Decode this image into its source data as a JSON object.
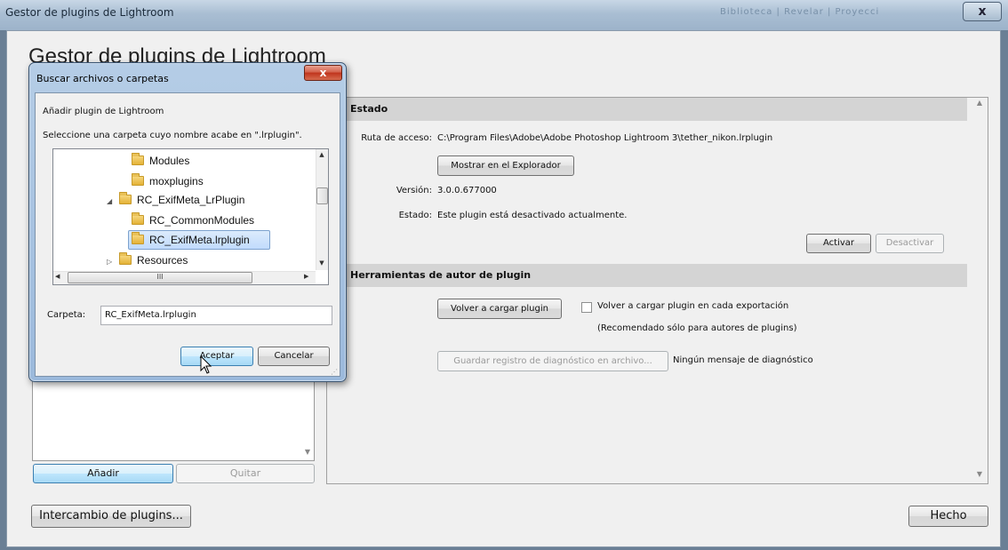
{
  "main_window": {
    "title": "Gestor de plugins de Lightroom",
    "titlebar_faded": "Biblioteca | Revelar | Proyecci",
    "close_label": "x",
    "heading": "Gestor de plugins de Lightroom"
  },
  "left_panel": {
    "add_label": "Añadir",
    "remove_label": "Quitar"
  },
  "status_section": {
    "header": "Estado",
    "path_label": "Ruta de acceso:",
    "path_value": "C:\\Program Files\\Adobe\\Adobe Photoshop Lightroom 3\\tether_nikon.lrplugin",
    "show_explorer_label": "Mostrar en el Explorador",
    "version_label": "Versión:",
    "version_value": "3.0.0.677000",
    "state_label": "Estado:",
    "state_value": "Este plugin está desactivado actualmente.",
    "activate_label": "Activar",
    "deactivate_label": "Desactivar"
  },
  "tools_section": {
    "header": "Herramientas de autor de plugin",
    "reload_label": "Volver a cargar plugin",
    "reload_each_export_label": "Volver a cargar plugin en cada exportación",
    "reload_each_export_checked": false,
    "recommended_note": "(Recomendado sólo para autores de plugins)",
    "save_log_label": "Guardar registro de diagnóstico en archivo...",
    "no_messages_label": "Ningún mensaje de diagnóstico"
  },
  "footer": {
    "exchange_label": "Intercambio de plugins...",
    "done_label": "Hecho"
  },
  "browse_dialog": {
    "title": "Buscar archivos o carpetas",
    "close_label": "x",
    "heading": "Añadir plugin de Lightroom",
    "instructions": "Seleccione una carpeta cuyo nombre acabe en \".lrplugin\".",
    "tree": [
      {
        "label": "Modules",
        "expander": "",
        "selected": false
      },
      {
        "label": "moxplugins",
        "expander": "",
        "selected": false
      },
      {
        "label": "RC_ExifMeta_LrPlugin",
        "expander": "◢",
        "selected": false
      },
      {
        "label": "RC_CommonModules",
        "expander": "",
        "selected": false
      },
      {
        "label": "RC_ExifMeta.lrplugin",
        "expander": "",
        "selected": true
      },
      {
        "label": "Resources",
        "expander": "▷",
        "selected": false
      }
    ],
    "hscroll_grip": "III",
    "folder_label": "Carpeta:",
    "folder_value": "RC_ExifMeta.lrplugin",
    "accept_label": "Aceptar",
    "cancel_label": "Cancelar"
  },
  "icons": {
    "folder": "folder-icon",
    "scroll_up": "▲",
    "scroll_down": "▼",
    "scroll_left": "◀",
    "scroll_right": "▶"
  },
  "colors": {
    "section_header_bg": "#d4d4d4",
    "selection_bg": "#c1dbfc",
    "dialog_frame": "#9bb9dc",
    "close_red": "#c0341c"
  }
}
